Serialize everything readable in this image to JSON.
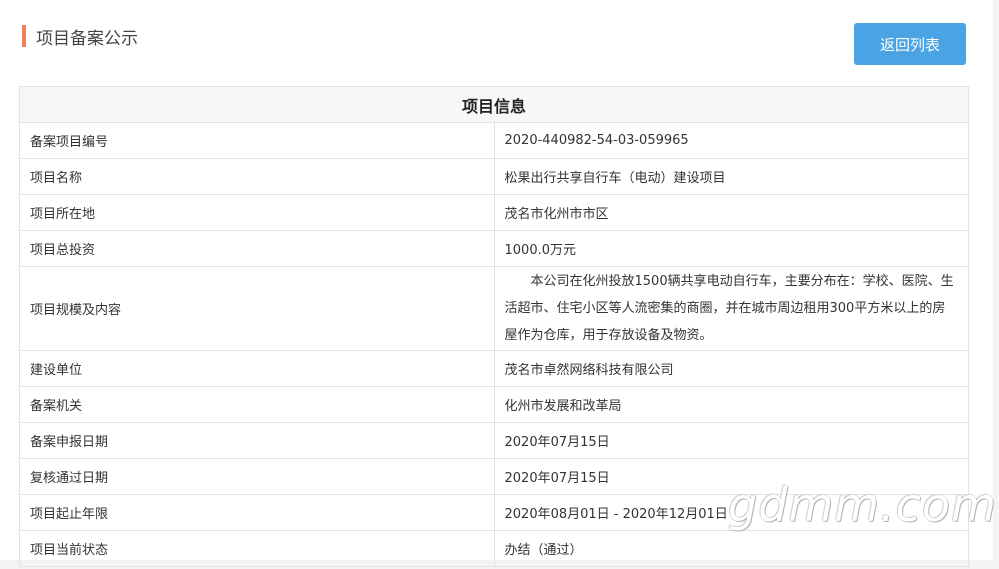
{
  "header": {
    "title": "项目备案公示",
    "back_button_label": "返回列表"
  },
  "table": {
    "title": "项目信息",
    "rows": [
      {
        "label": "备案项目编号",
        "value": "2020-440982-54-03-059965"
      },
      {
        "label": "项目名称",
        "value": "松果出行共享自行车（电动）建设项目"
      },
      {
        "label": "项目所在地",
        "value": "茂名市化州市市区"
      },
      {
        "label": "项目总投资",
        "value": "1000.0万元"
      },
      {
        "label": "项目规模及内容",
        "value": "　　本公司在化州投放1500辆共享电动自行车，主要分布在：学校、医院、生活超市、住宅小区等人流密集的商圈，并在城市周边租用300平方米以上的房屋作为仓库，用于存放设备及物资。"
      },
      {
        "label": "建设单位",
        "value": "茂名市卓然网络科技有限公司"
      },
      {
        "label": "备案机关",
        "value": "化州市发展和改革局"
      },
      {
        "label": "备案申报日期",
        "value": "2020年07月15日"
      },
      {
        "label": "复核通过日期",
        "value": "2020年07月15日"
      },
      {
        "label": "项目起止年限",
        "value": "2020年08月01日 - 2020年12月01日"
      },
      {
        "label": "项目当前状态",
        "value": "办结（通过）"
      }
    ]
  },
  "watermark": "gdmm.com",
  "colors": {
    "accent": "#f47f5d",
    "button": "#4aa3e2"
  }
}
